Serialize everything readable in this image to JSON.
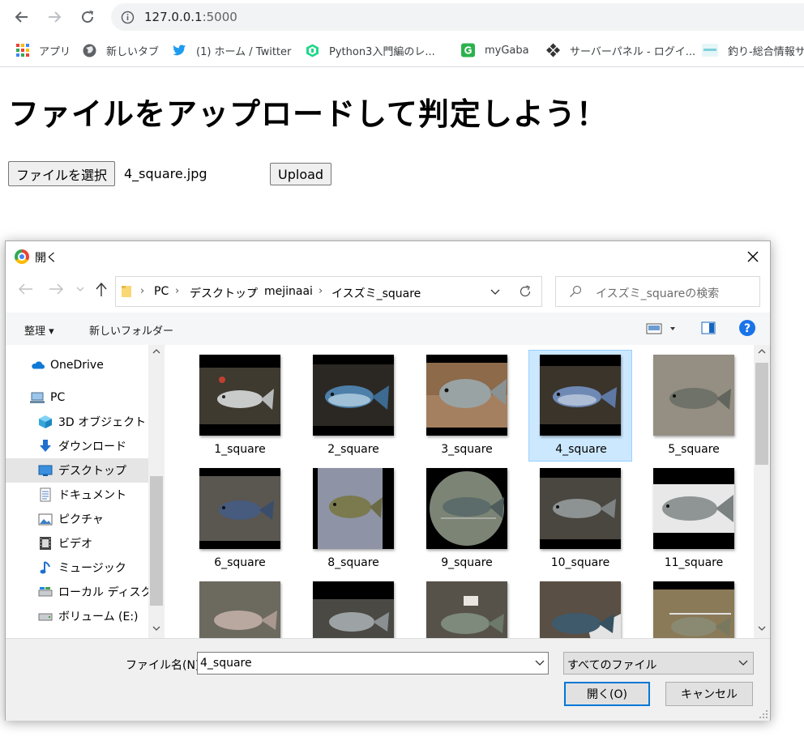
{
  "browser": {
    "url_host": "127.0.0.1",
    "url_port": ":5000",
    "bookmarks": [
      {
        "label": "アプリ",
        "icon": "apps-grid-icon"
      },
      {
        "label": "新しいタブ",
        "icon": "globe-icon"
      },
      {
        "label": "(1) ホーム / Twitter",
        "icon": "twitter-icon"
      },
      {
        "label": "Python3入門編のレ...",
        "icon": "pycharm-icon"
      },
      {
        "label": "myGaba",
        "icon": "mygaba-icon"
      },
      {
        "label": "サーバーパネル - ログイ...",
        "icon": "server-panel-icon"
      },
      {
        "label": "釣り-総合情報サ",
        "icon": "fishing-site-icon"
      }
    ]
  },
  "page": {
    "heading": "ファイルをアップロードして判定しよう！",
    "choose_file_label": "ファイルを選択",
    "chosen_file": "4_square.jpg",
    "upload_label": "Upload"
  },
  "dialog": {
    "title": "開く",
    "breadcrumbs": [
      "PC",
      "デスクトップ",
      "mejinaai",
      "イスズミ_square"
    ],
    "search_placeholder": "イスズミ_squareの検索",
    "organize_label": "整理 ▾",
    "new_folder_label": "新しいフォルダー",
    "nav_items": [
      {
        "label": "OneDrive",
        "icon": "onedrive-icon"
      },
      {
        "label": "PC",
        "icon": "pc-icon"
      },
      {
        "label": "3D オブジェクト",
        "icon": "3d-objects-icon"
      },
      {
        "label": "ダウンロード",
        "icon": "download-icon"
      },
      {
        "label": "デスクトップ",
        "icon": "desktop-icon",
        "selected": true
      },
      {
        "label": "ドキュメント",
        "icon": "document-icon"
      },
      {
        "label": "ピクチャ",
        "icon": "pictures-icon"
      },
      {
        "label": "ビデオ",
        "icon": "video-icon"
      },
      {
        "label": "ミュージック",
        "icon": "music-icon"
      },
      {
        "label": "ローカル ディスク (C",
        "icon": "local-disk-icon"
      },
      {
        "label": "ボリューム (E:)",
        "icon": "volume-drive-icon"
      }
    ],
    "files": [
      {
        "name": "1_square"
      },
      {
        "name": "2_square"
      },
      {
        "name": "3_square"
      },
      {
        "name": "4_square",
        "selected": true
      },
      {
        "name": "5_square"
      },
      {
        "name": "6_square"
      },
      {
        "name": "8_square"
      },
      {
        "name": "9_square"
      },
      {
        "name": "10_square"
      },
      {
        "name": "11_square"
      },
      {
        "name": ""
      },
      {
        "name": ""
      },
      {
        "name": ""
      },
      {
        "name": ""
      },
      {
        "name": ""
      }
    ],
    "filename_label": "ファイル名(N):",
    "filename_value": "4_square",
    "filetype_value": "すべてのファイル",
    "open_label": "開く(O)",
    "cancel_label": "キャンセル",
    "colors": {
      "selection": "#cce8ff",
      "accent": "#0078d7",
      "help": "#1a73e8"
    }
  }
}
